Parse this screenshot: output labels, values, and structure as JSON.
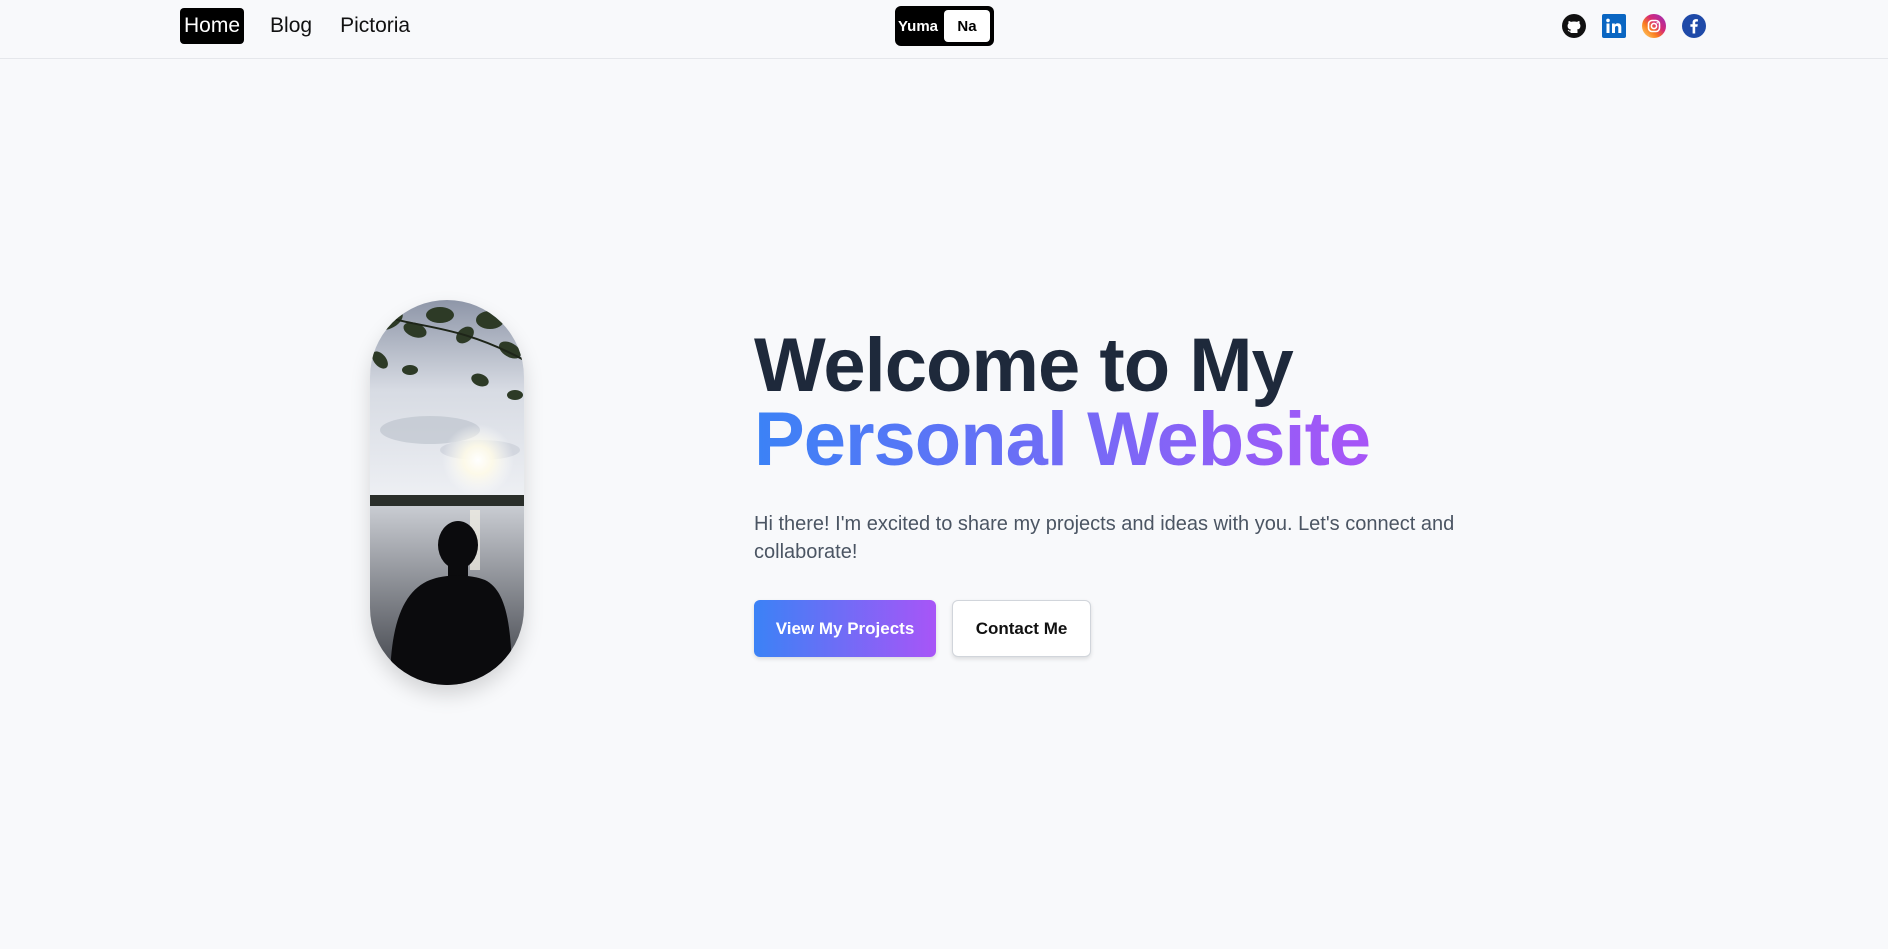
{
  "nav": {
    "items": [
      {
        "label": "Home",
        "active": true
      },
      {
        "label": "Blog",
        "active": false
      },
      {
        "label": "Pictoria",
        "active": false
      }
    ]
  },
  "language_toggle": {
    "left_label": "Yuma",
    "right_label": "Na"
  },
  "social": [
    {
      "icon": "github-icon",
      "color": "#111111"
    },
    {
      "icon": "linkedin-icon",
      "color": "#0a66c2"
    },
    {
      "icon": "instagram-icon",
      "color": "#c13584"
    },
    {
      "icon": "facebook-icon",
      "color": "#1877f2"
    }
  ],
  "hero": {
    "title_line1": "Welcome to My",
    "title_line2": "Personal Website",
    "subtitle": "Hi there! I'm excited to share my projects and ideas with you. Let's connect and collaborate!",
    "primary_button": "View My Projects",
    "secondary_button": "Contact Me"
  },
  "colors": {
    "gradient_start": "#3b82f6",
    "gradient_end": "#a855f7",
    "title": "#1e293b"
  }
}
